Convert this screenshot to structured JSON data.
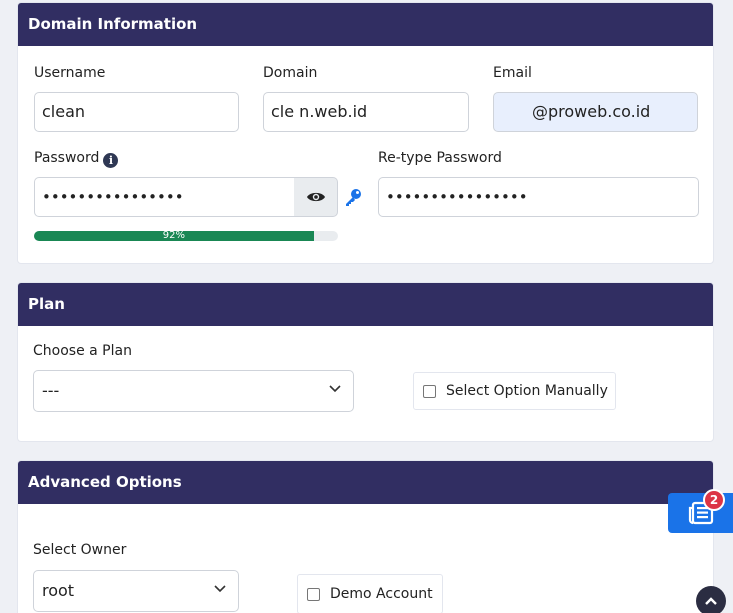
{
  "domain_panel": {
    "title": "Domain Information",
    "username_label": "Username",
    "username_value": "clean",
    "domain_label": "Domain",
    "domain_value": "cle  n.web.id",
    "email_label": "Email",
    "email_value": "@proweb.co.id",
    "password_label": "Password",
    "password_value": "••••••••••••••••",
    "retype_label": "Re-type Password",
    "retype_value": "••••••••••••••••",
    "strength_percent": 92,
    "strength_text": "92%",
    "icons": {
      "info": "info-icon",
      "eye": "eye-icon",
      "key": "key-icon"
    }
  },
  "plan_panel": {
    "title": "Plan",
    "choose_label": "Choose a Plan",
    "plan_value": "---",
    "manual_option_label": "Select Option Manually"
  },
  "advanced_panel": {
    "title": "Advanced Options",
    "owner_label": "Select Owner",
    "owner_value": "root",
    "demo_label": "Demo Account"
  },
  "floating": {
    "badge_count": "2",
    "icon": "newspaper-icon",
    "scroll_icon": "chevron-up-icon"
  },
  "colors": {
    "header_bg": "#312e62",
    "progress": "#198754",
    "accent": "#1a73e8",
    "badge": "#dc3545"
  }
}
